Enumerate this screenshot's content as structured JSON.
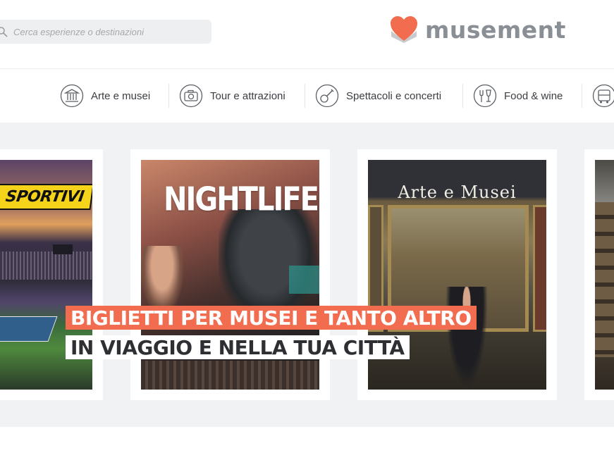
{
  "header": {
    "search": {
      "placeholder": "Cerca esperienze o destinazioni",
      "icon": "search-icon"
    },
    "logo": {
      "text": "musement",
      "mark_icon": "heart-logo-icon"
    }
  },
  "nav": {
    "items": [
      {
        "label": "Arte e musei",
        "icon": "museum-icon"
      },
      {
        "label": "Tour e attrazioni",
        "icon": "camera-icon"
      },
      {
        "label": "Spettacoli e concerti",
        "icon": "guitar-icon"
      },
      {
        "label": "Food & wine",
        "icon": "food-wine-icon"
      },
      {
        "label": "",
        "icon": "bus-icon"
      }
    ]
  },
  "hero": {
    "cards": [
      {
        "title": "SPORTIVI"
      },
      {
        "title": "NIGHTLIFE"
      },
      {
        "title": "Arte e Musei"
      },
      {
        "title": ""
      }
    ],
    "banner": {
      "line1": "BIGLIETTI PER MUSEI E TANTO ALTRO",
      "line2": "IN VIAGGIO E NELLA TUA CITTÀ"
    }
  },
  "colors": {
    "accent": "#f26d4f",
    "logo_text": "#8a8f96",
    "hero_background": "#f0f2f4",
    "sport_tag": "#f5d31b"
  }
}
